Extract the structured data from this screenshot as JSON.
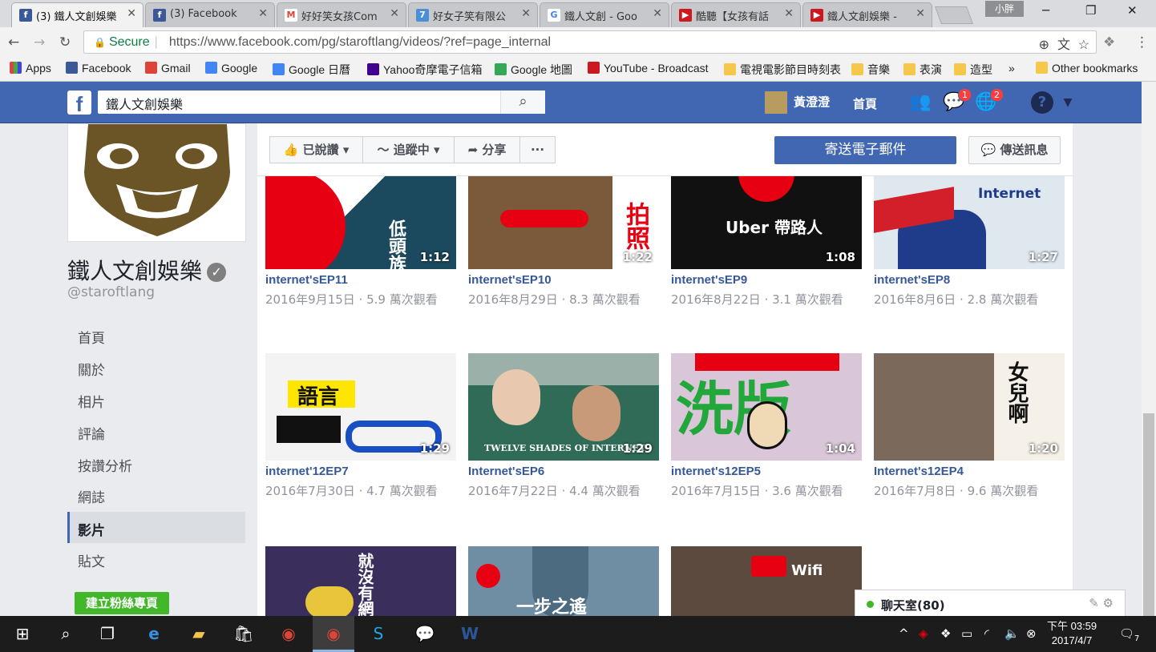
{
  "browser": {
    "tabs": [
      {
        "label": "(3) 鐵人文創娛樂",
        "icon": "facebook-icon",
        "color": "#3b5998"
      },
      {
        "label": "(3) Facebook",
        "icon": "facebook-icon",
        "color": "#3b5998"
      },
      {
        "label": "好好笑女孩Com",
        "icon": "gmail-icon",
        "color": "#ffffff"
      },
      {
        "label": "好女子笑有限公",
        "icon": "calendar-icon",
        "color": "#4a90d9"
      },
      {
        "label": "鐵人文創 - Goo",
        "icon": "google-icon",
        "color": "#ffffff"
      },
      {
        "label": "酷聽【女孩有話",
        "icon": "youtube-icon",
        "color": "#cc181e"
      },
      {
        "label": "鐵人文創娛樂 -",
        "icon": "youtube-icon",
        "color": "#cc181e"
      }
    ],
    "profile_name": "小胖",
    "secure_label": "Secure",
    "url": "https://www.facebook.com/pg/staroftlang/videos/?ref=page_internal",
    "bookmarks": [
      {
        "label": "Apps",
        "color": "#d44"
      },
      {
        "label": "Facebook",
        "color": "#3b5998"
      },
      {
        "label": "Gmail",
        "color": "#db4437"
      },
      {
        "label": "Google",
        "color": "#4285f4"
      },
      {
        "label": "Google 日曆",
        "color": "#4285f4"
      },
      {
        "label": "Yahoo奇摩電子信箱",
        "color": "#400090"
      },
      {
        "label": "Google 地圖",
        "color": "#34a853"
      },
      {
        "label": "YouTube - Broadcast",
        "color": "#cc181e"
      },
      {
        "label": "電視電影節目時刻表",
        "color": "#f5c84c"
      },
      {
        "label": "音樂",
        "color": "#f5c84c"
      },
      {
        "label": "表演",
        "color": "#f5c84c"
      },
      {
        "label": "造型",
        "color": "#f5c84c"
      },
      {
        "label": "»",
        "color": ""
      },
      {
        "label": "Other bookmarks",
        "color": "#f5c84c"
      }
    ]
  },
  "fb": {
    "search_value": "鐵人文創娛樂",
    "user_name": "黃澄澄",
    "home_label": "首頁",
    "messages_badge": "1",
    "notifications_badge": "2"
  },
  "page": {
    "name": "鐵人文創娛樂",
    "handle": "@staroftlang",
    "nav": [
      "首頁",
      "關於",
      "相片",
      "評論",
      "按讚分析",
      "網誌",
      "影片",
      "貼文"
    ],
    "active_nav": "影片",
    "create_fanpage": "建立粉絲專頁"
  },
  "actions": {
    "liked": "已說讚",
    "following": "追蹤中",
    "share": "分享",
    "more": "···",
    "send_email": "寄送電子郵件",
    "send_message": "傳送訊息"
  },
  "videos": [
    {
      "title": "internet'sEP11",
      "meta": "2016年9月15日 · 5.9 萬次觀看",
      "duration": "1:12",
      "thumb_text": "低頭族",
      "bg": "#1b4a5e"
    },
    {
      "title": "internet'sEP10",
      "meta": "2016年8月29日 · 8.3 萬次觀看",
      "duration": "1:22",
      "thumb_text": "拍照",
      "bg": "#7a5a3a"
    },
    {
      "title": "internet'sEP9",
      "meta": "2016年8月22日 · 3.1 萬次觀看",
      "duration": "1:08",
      "thumb_text": "Uber 帶路人",
      "bg": "#111111"
    },
    {
      "title": "internet'sEP8",
      "meta": "2016年8月6日 · 2.8 萬次觀看",
      "duration": "1:27",
      "thumb_text": "Internet",
      "bg": "#dfe8ef"
    },
    {
      "title": "internet'12EP7",
      "meta": "2016年7月30日 · 4.7 萬次觀看",
      "duration": "1:29",
      "thumb_text": "語言",
      "bg": "#f3f3f3"
    },
    {
      "title": "Internet'sEP6",
      "meta": "2016年7月22日 · 4.4 萬次觀看",
      "duration": "1:29",
      "thumb_text": "TWELVE SHADES OF INTERNET",
      "bg": "#2f6b57"
    },
    {
      "title": "internet's12EP5",
      "meta": "2016年7月15日 · 3.6 萬次觀看",
      "duration": "1:04",
      "thumb_text": "洗版",
      "bg": "#d9c6d8"
    },
    {
      "title": "Internet's12EP4",
      "meta": "2016年7月8日 · 9.6 萬次觀看",
      "duration": "1:20",
      "thumb_text": "女兒啊",
      "bg": "#7b6a5c"
    },
    {
      "title": "",
      "meta": "",
      "duration": "",
      "thumb_text": "就沒有網",
      "bg": "#3a2f5c"
    },
    {
      "title": "",
      "meta": "",
      "duration": "",
      "thumb_text": "一步之遙",
      "bg": "#6f8ea3"
    },
    {
      "title": "",
      "meta": "",
      "duration": "",
      "thumb_text": "Wifi",
      "bg": "#5c4a3e"
    }
  ],
  "chat": {
    "label": "聊天室(80)"
  },
  "taskbar": {
    "time": "下午 03:59",
    "date": "2017/4/7",
    "notif_count": "7"
  }
}
